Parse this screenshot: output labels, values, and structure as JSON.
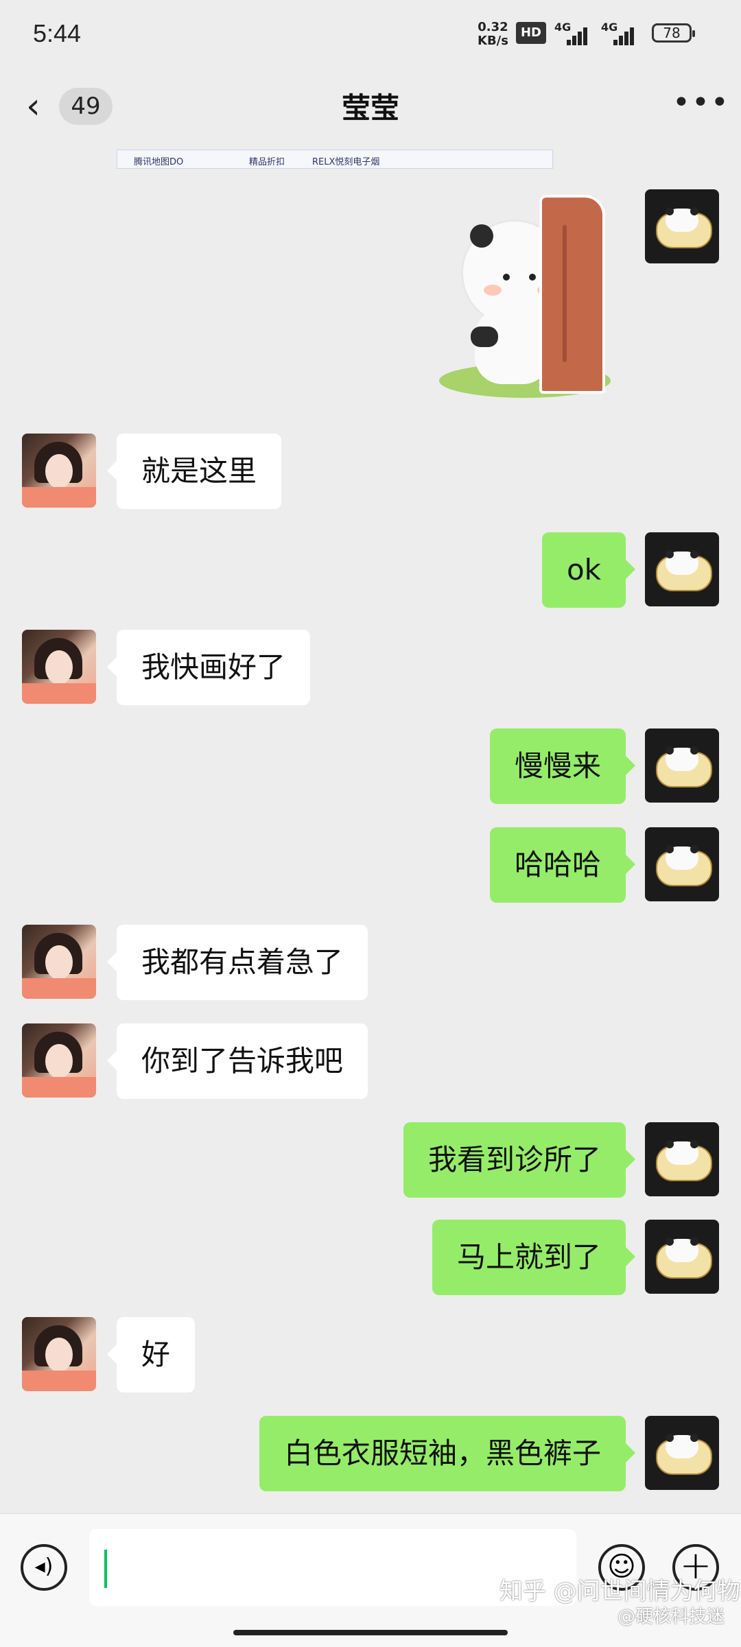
{
  "status": {
    "time": "5:44",
    "net_speed": "0.32",
    "net_unit": "KB/s",
    "hd": "HD",
    "sig1": "4G",
    "sig2": "4G",
    "battery": "78"
  },
  "header": {
    "back_icon": "chevron-left-icon",
    "unread_count": "49",
    "title": "莹莹",
    "more_icon": "more-dots-icon",
    "more_text": "•••"
  },
  "map_strip": {
    "label1": "腾讯地图DO",
    "label2": "精品折扣",
    "label3": "RELX悦刻电子烟"
  },
  "messages": [
    {
      "side": "out",
      "type": "sticker",
      "text": ""
    },
    {
      "side": "in",
      "text": "就是这里"
    },
    {
      "side": "out",
      "text": "ok"
    },
    {
      "side": "in",
      "text": "我快画好了"
    },
    {
      "side": "out",
      "text": "慢慢来"
    },
    {
      "side": "out",
      "text": "哈哈哈"
    },
    {
      "side": "in",
      "text": "我都有点着急了"
    },
    {
      "side": "in",
      "text": "你到了告诉我吧"
    },
    {
      "side": "out",
      "text": "我看到诊所了"
    },
    {
      "side": "out",
      "text": "马上就到了"
    },
    {
      "side": "in",
      "text": "好"
    },
    {
      "side": "out",
      "text": "白色衣服短袖，黑色裤子"
    }
  ],
  "input_bar": {
    "voice_icon": "voice-icon",
    "emoji_icon": "emoji-icon",
    "plus_icon": "plus-icon",
    "voice_glyph": "◂)",
    "emoji_glyph": "☺",
    "plus_glyph": "+"
  },
  "watermark": {
    "line1": "知乎 @问世间情为何物",
    "line2": "@硬核科技迷"
  },
  "colors": {
    "background": "#ededed",
    "outgoing_bubble": "#95ec69",
    "incoming_bubble": "#ffffff",
    "caret": "#07c160"
  }
}
